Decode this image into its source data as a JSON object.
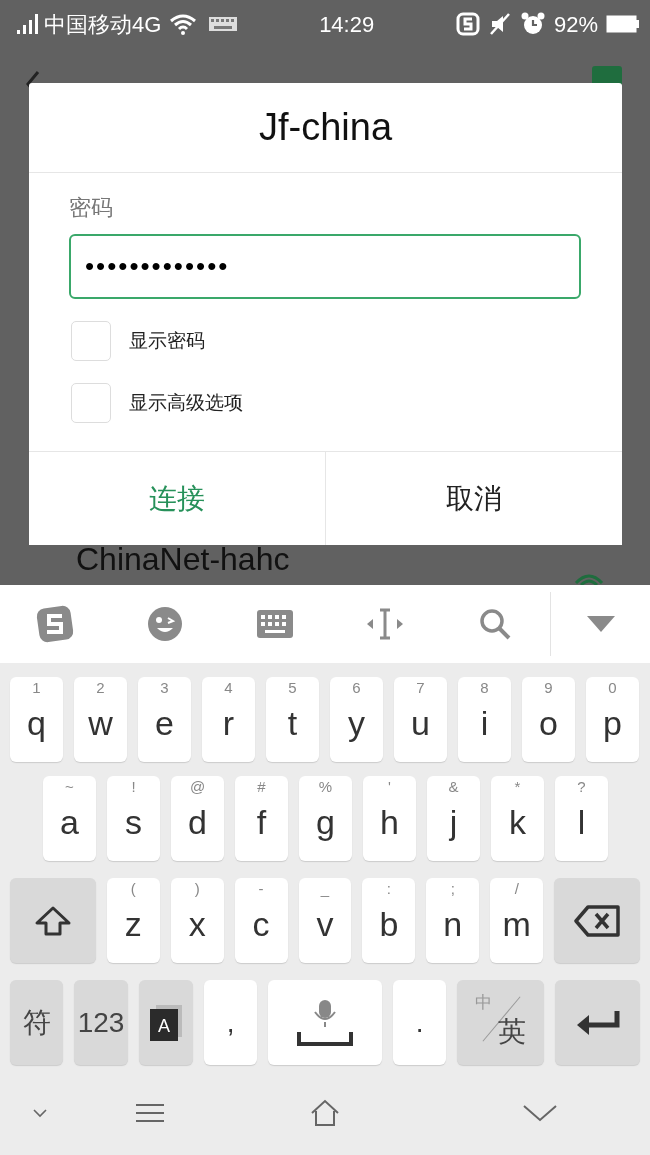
{
  "status_bar": {
    "carrier": "中国移动4G",
    "time": "14:29",
    "battery": "92%"
  },
  "background_list": {
    "network": "ChinaNet-hahc"
  },
  "dialog": {
    "title": "Jf-china",
    "field_label": "密码",
    "password": "•••••••••••••",
    "options": [
      {
        "label": "显示密码",
        "checked": false
      },
      {
        "label": "显示高级选项",
        "checked": false
      }
    ],
    "buttons": [
      {
        "label": "连接",
        "kind": "primary"
      },
      {
        "label": "取消",
        "kind": "default"
      }
    ]
  },
  "keyboard": {
    "rows": [
      {
        "keys": [
          {
            "kind": "letter",
            "label": "q",
            "hint": "1"
          },
          {
            "kind": "letter",
            "label": "w",
            "hint": "2"
          },
          {
            "kind": "letter",
            "label": "e",
            "hint": "3"
          },
          {
            "kind": "letter",
            "label": "r",
            "hint": "4"
          },
          {
            "kind": "letter",
            "label": "t",
            "hint": "5"
          },
          {
            "kind": "letter",
            "label": "y",
            "hint": "6"
          },
          {
            "kind": "letter",
            "label": "u",
            "hint": "7"
          },
          {
            "kind": "letter",
            "label": "i",
            "hint": "8"
          },
          {
            "kind": "letter",
            "label": "o",
            "hint": "9"
          },
          {
            "kind": "letter",
            "label": "p",
            "hint": "0"
          }
        ]
      },
      {
        "keys": [
          {
            "kind": "letter",
            "label": "a",
            "hint": "~"
          },
          {
            "kind": "letter",
            "label": "s",
            "hint": "!"
          },
          {
            "kind": "letter",
            "label": "d",
            "hint": "@"
          },
          {
            "kind": "letter",
            "label": "f",
            "hint": "#"
          },
          {
            "kind": "letter",
            "label": "g",
            "hint": "%"
          },
          {
            "kind": "letter",
            "label": "h",
            "hint": "'"
          },
          {
            "kind": "letter",
            "label": "j",
            "hint": "&"
          },
          {
            "kind": "letter",
            "label": "k",
            "hint": "*"
          },
          {
            "kind": "letter",
            "label": "l",
            "hint": "?"
          }
        ]
      },
      {
        "keys": [
          {
            "kind": "shift"
          },
          {
            "kind": "letter",
            "label": "z",
            "hint": "("
          },
          {
            "kind": "letter",
            "label": "x",
            "hint": ")"
          },
          {
            "kind": "letter",
            "label": "c",
            "hint": "-"
          },
          {
            "kind": "letter",
            "label": "v",
            "hint": "_"
          },
          {
            "kind": "letter",
            "label": "b",
            "hint": ":"
          },
          {
            "kind": "letter",
            "label": "n",
            "hint": ";"
          },
          {
            "kind": "letter",
            "label": "m",
            "hint": "/"
          },
          {
            "kind": "backspace"
          }
        ]
      },
      {
        "keys": [
          {
            "kind": "function",
            "label": "符"
          },
          {
            "kind": "function",
            "label": "123"
          },
          {
            "kind": "layout",
            "label": "A"
          },
          {
            "kind": "punct",
            "label": ","
          },
          {
            "kind": "space"
          },
          {
            "kind": "punct",
            "label": "."
          },
          {
            "kind": "lang",
            "label": "中",
            "hint": "英"
          },
          {
            "kind": "enter"
          }
        ]
      }
    ]
  }
}
